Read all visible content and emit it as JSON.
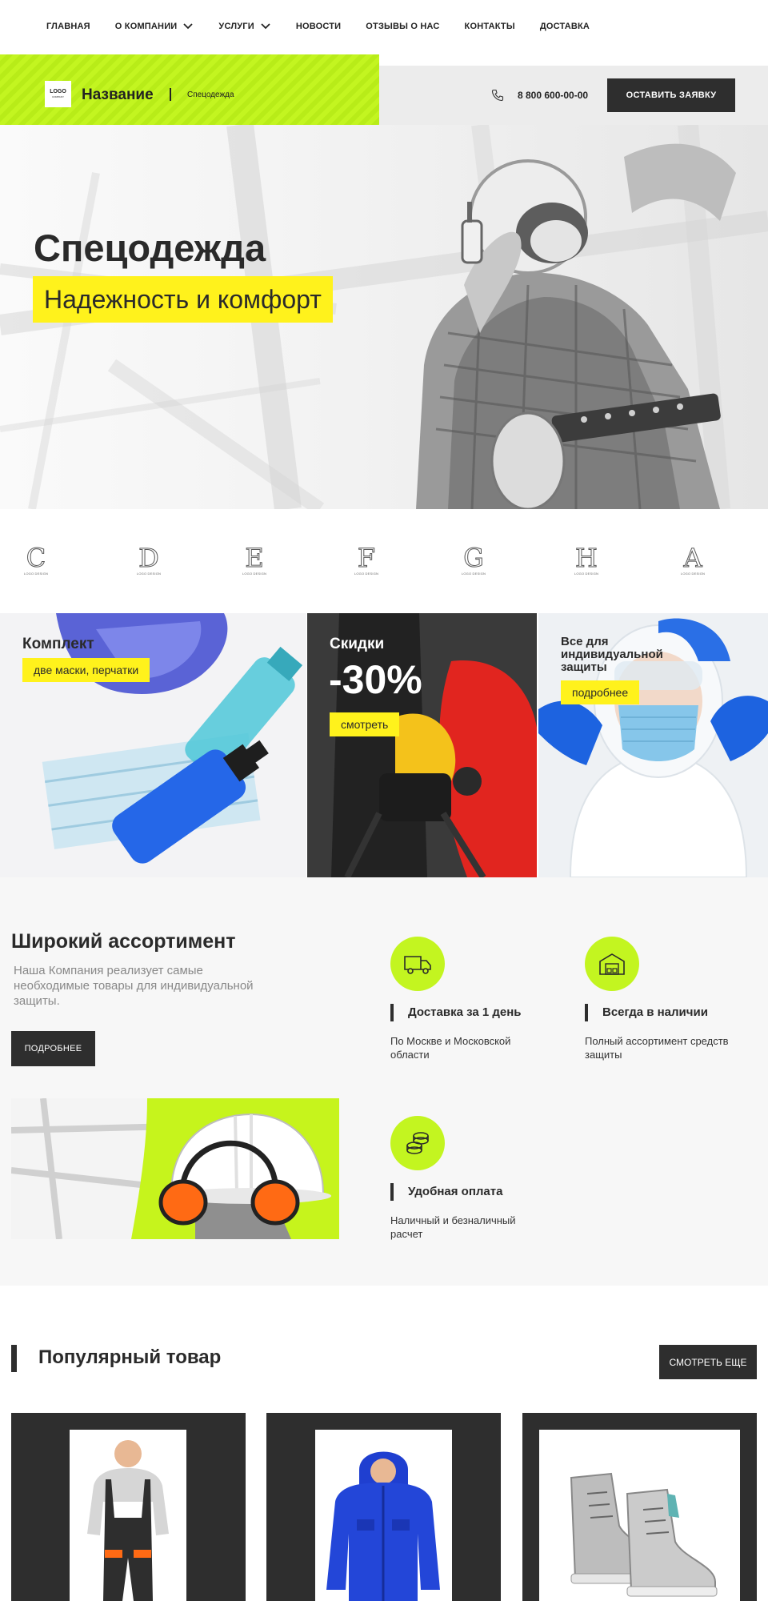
{
  "nav": {
    "items": [
      {
        "label": "ГЛАВНАЯ",
        "has_dropdown": false
      },
      {
        "label": "О КОМПАНИИ",
        "has_dropdown": true
      },
      {
        "label": "УСЛУГИ",
        "has_dropdown": true
      },
      {
        "label": "НОВОСТИ",
        "has_dropdown": false
      },
      {
        "label": "ОТЗЫВЫ О НАС",
        "has_dropdown": false
      },
      {
        "label": "КОНТАКТЫ",
        "has_dropdown": false
      },
      {
        "label": "ДОСТАВКА",
        "has_dropdown": false
      }
    ]
  },
  "header": {
    "logo_text": "LOGO",
    "logo_caption": "COMPANY",
    "brand_name": "Название",
    "brand_sub": "Спецодежда",
    "phone": "8 800 600-00-00",
    "cta": "ОСТАВИТЬ ЗАЯВКУ"
  },
  "hero": {
    "title": "Спецодежда",
    "subtitle": "Надежность и комфорт"
  },
  "partners": {
    "caption": "LOGO DESIGN",
    "letters": [
      "C",
      "D",
      "E",
      "F",
      "G",
      "H",
      "A"
    ]
  },
  "promos": [
    {
      "title": "Комплект",
      "tag": "две маски, перчатки"
    },
    {
      "title": "Скидки",
      "big": "-30%",
      "tag": "смотреть"
    },
    {
      "title_line1": "Все для",
      "title_line2": "индивидуальной",
      "title_line3": "защиты",
      "tag": "подробнее"
    }
  ],
  "features": {
    "heading": "Широкий ассортимент",
    "text": "Наша Компания реализует самые необходимые товары для индивидуальной защиты.",
    "button": "ПОДРОБНЕЕ",
    "items": [
      {
        "icon": "truck-icon",
        "title": "Доставка за 1 день",
        "desc": "По Москве и Московской области"
      },
      {
        "icon": "warehouse-icon",
        "title": "Всегда в наличии",
        "desc": "Полный ассортимент средств защиты"
      },
      {
        "icon": "coins-icon",
        "title": "Удобная оплата",
        "desc": "Наличный и безналичный расчет"
      }
    ]
  },
  "popular": {
    "title": "Популярный товар",
    "button": "СМОТРЕТЬ ЕЩЕ"
  },
  "colors": {
    "accent_green": "#c3f520",
    "accent_yellow": "#fff21c",
    "dark": "#2e2e2e"
  }
}
